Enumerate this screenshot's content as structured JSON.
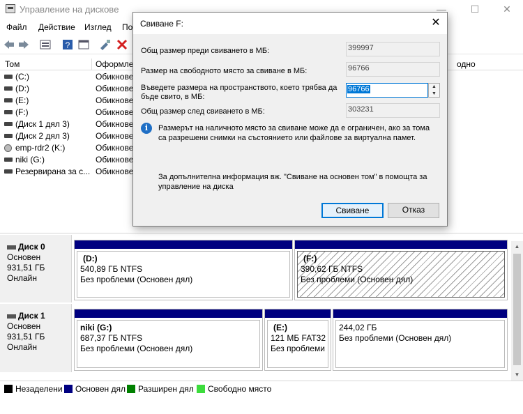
{
  "window": {
    "title": "Управление на дисковe",
    "min_glyph": "—",
    "max_glyph": "☐",
    "close_glyph": "✕"
  },
  "menu": [
    "Файл",
    "Действие",
    "Изглед",
    "По"
  ],
  "list": {
    "headers": [
      "Том",
      "Оформле",
      "одно"
    ],
    "rows": [
      {
        "name": "(C:)",
        "layout": "Обикнове",
        "icon": "drive-icon"
      },
      {
        "name": "(D:)",
        "layout": "Обикнове",
        "icon": "drive-icon"
      },
      {
        "name": "(E:)",
        "layout": "Обикнове",
        "icon": "drive-icon"
      },
      {
        "name": "(F:)",
        "layout": "Обикнове",
        "icon": "drive-icon"
      },
      {
        "name": "(Диск 1 дял 3)",
        "layout": "Обикнове",
        "icon": "drive-icon"
      },
      {
        "name": "(Диск 2 дял 3)",
        "layout": "Обикнове",
        "icon": "drive-icon"
      },
      {
        "name": "emp-rdr2 (K:)",
        "layout": "Обикнове",
        "icon": "cd-drive-icon"
      },
      {
        "name": "niki (G:)",
        "layout": "Обикнове",
        "icon": "drive-icon"
      },
      {
        "name": "Резервирана за с...",
        "layout": "Обикнове",
        "icon": "drive-icon"
      }
    ]
  },
  "disks": [
    {
      "name": "Диск 0",
      "type": "Основен",
      "size": "931,51 ГБ",
      "status": "Онлайн",
      "partitions": [
        {
          "title": "(D:)",
          "info": "540,89 ГБ NTFS",
          "status": "Без проблеми (Основен дял)"
        },
        {
          "title": "(F:)",
          "info": "390,62 ГБ NTFS",
          "status": "Без проблеми (Основен дял)"
        }
      ]
    },
    {
      "name": "Диск 1",
      "type": "Основен",
      "size": "931,51 ГБ",
      "status": "Онлайн",
      "partitions": [
        {
          "title": "niki  (G:)",
          "info": "687,37 ГБ NTFS",
          "status": "Без проблеми (Основен дял)"
        },
        {
          "title": "(E:)",
          "info": "121 МБ FAT32",
          "status": "Без проблеми"
        },
        {
          "title": "",
          "info": "244,02 ГБ",
          "status": "Без проблеми (Основен дял)"
        }
      ]
    }
  ],
  "legend": [
    {
      "label": "Незаделени",
      "color": "#000000"
    },
    {
      "label": "Основен дял",
      "color": "#000080"
    },
    {
      "label": "Разширен дял",
      "color": "#008000"
    },
    {
      "label": "Свободно място",
      "color": "#3cdc3c"
    }
  ],
  "dialog": {
    "title": "Свиване F:",
    "total_before_label": "Общ размер преди свиването в МБ:",
    "total_before_value": "399997",
    "available_label": "Размер на свободното място за свиване в МБ:",
    "available_value": "96766",
    "enter_label": "Въведете размера на пространството, което трябва да бъде свито, в МБ:",
    "enter_value": "96766",
    "total_after_label": "Общ размер след свиването в МБ:",
    "total_after_value": "303231",
    "info_text": "Размерът на наличното място за свиване може да е ограничен, ако за тома са разрешени снимки на състоянието или файлове за виртуална памет.",
    "help_text": "За допълнителна информация вж. \"Свиване на основен том\" в помощта за управление на диска",
    "shrink_button": "Свиване",
    "cancel_button": "Отказ",
    "close_glyph": "✕"
  }
}
